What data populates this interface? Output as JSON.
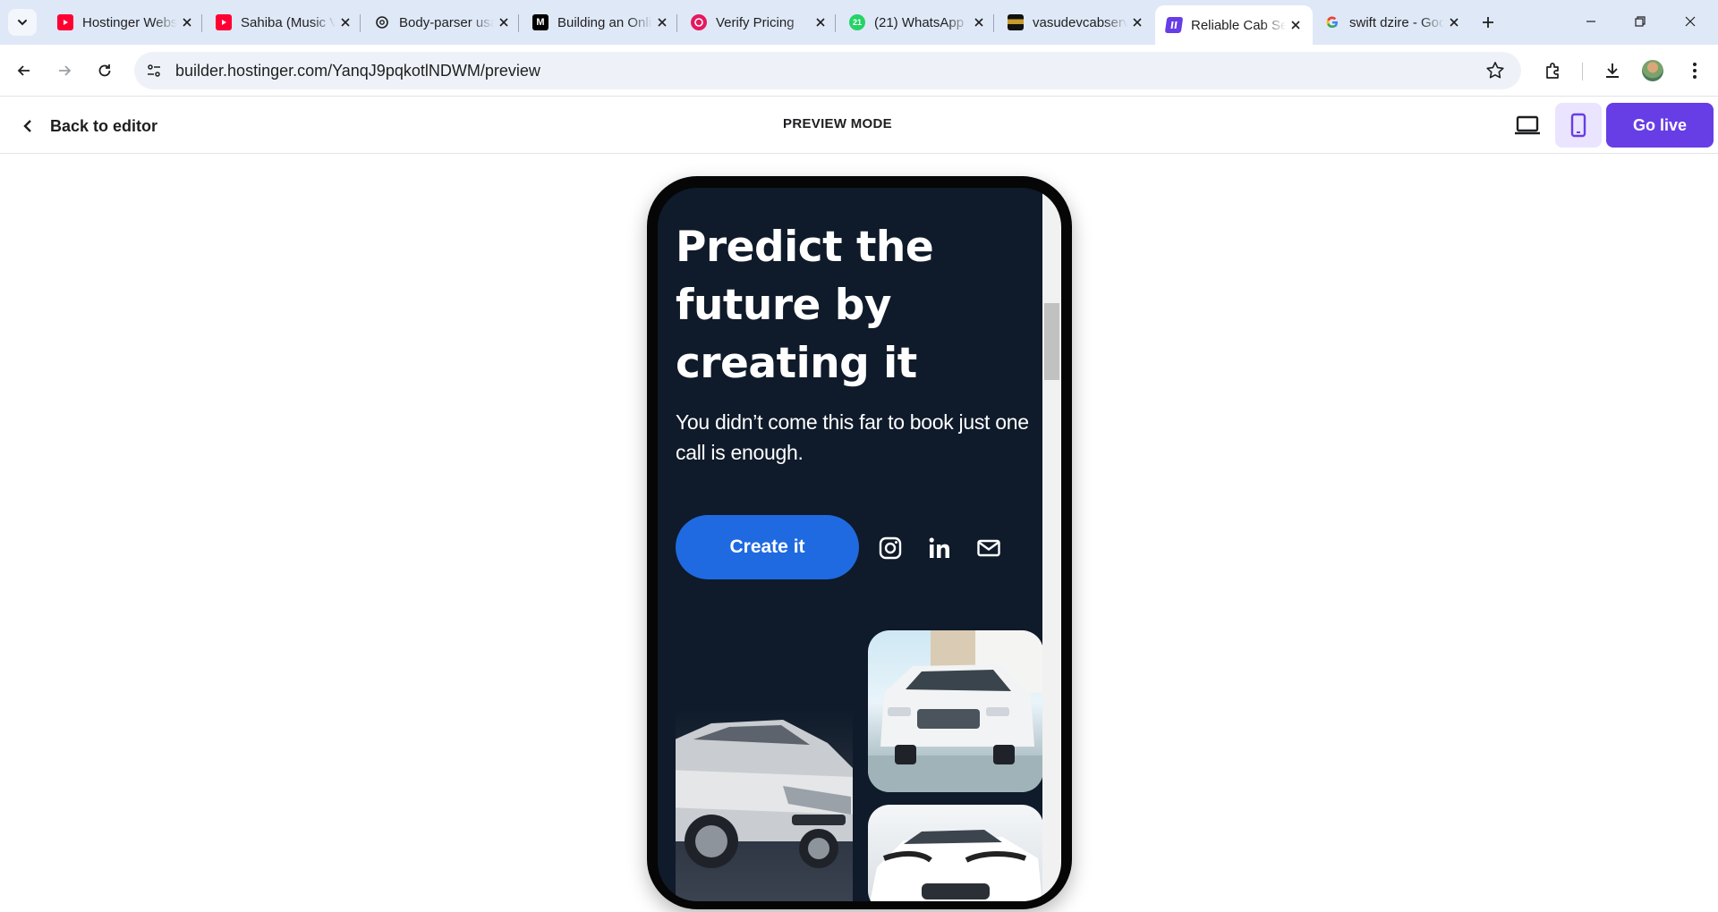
{
  "browser": {
    "tabs": [
      {
        "title": "Hostinger Website Builder",
        "favicon": "youtube-icon",
        "color": "#ff0033"
      },
      {
        "title": "Sahiba (Music Video)",
        "favicon": "youtube-icon",
        "color": "#ff0033"
      },
      {
        "title": "Body-parser usage",
        "favicon": "openai-icon",
        "color": "#1f1f1f"
      },
      {
        "title": "Building an Online",
        "favicon": "medium-icon",
        "color": "#000000"
      },
      {
        "title": "Verify Pricing",
        "favicon": "target-icon",
        "color": "#e5195e"
      },
      {
        "title": "(21) WhatsApp",
        "favicon": "whatsapp-icon",
        "color": "#25d366"
      },
      {
        "title": "vasudevcabservice",
        "favicon": "site-logo-icon",
        "color": "#3a2a12"
      },
      {
        "title": "Reliable Cab Service",
        "favicon": "hostinger-icon",
        "color": "#673de6"
      },
      {
        "title": "swift dzire - Google Search",
        "favicon": "google-icon",
        "color": "#4285f4"
      }
    ],
    "active_tab_index": 7,
    "whatsapp_badge": "21",
    "url": "builder.hostinger.com/YanqJ9pqkotlNDWM/preview"
  },
  "builder": {
    "back_label": "Back to editor",
    "mode_label": "PREVIEW MODE",
    "go_live_label": "Go live",
    "active_device": "mobile"
  },
  "preview": {
    "hero_title": "Predict the future by creating it",
    "hero_subtitle": "You didn’t come this far to book just one call is enough.",
    "cta_label": "Create it",
    "social_icons": [
      "instagram-icon",
      "linkedin-icon",
      "email-icon"
    ],
    "images": [
      "silver-sedan-image",
      "white-suv-image",
      "white-car-image"
    ]
  },
  "colors": {
    "brand_purple": "#673de6",
    "hero_background": "#0f1a2a",
    "cta_blue": "#1f6ae0"
  }
}
